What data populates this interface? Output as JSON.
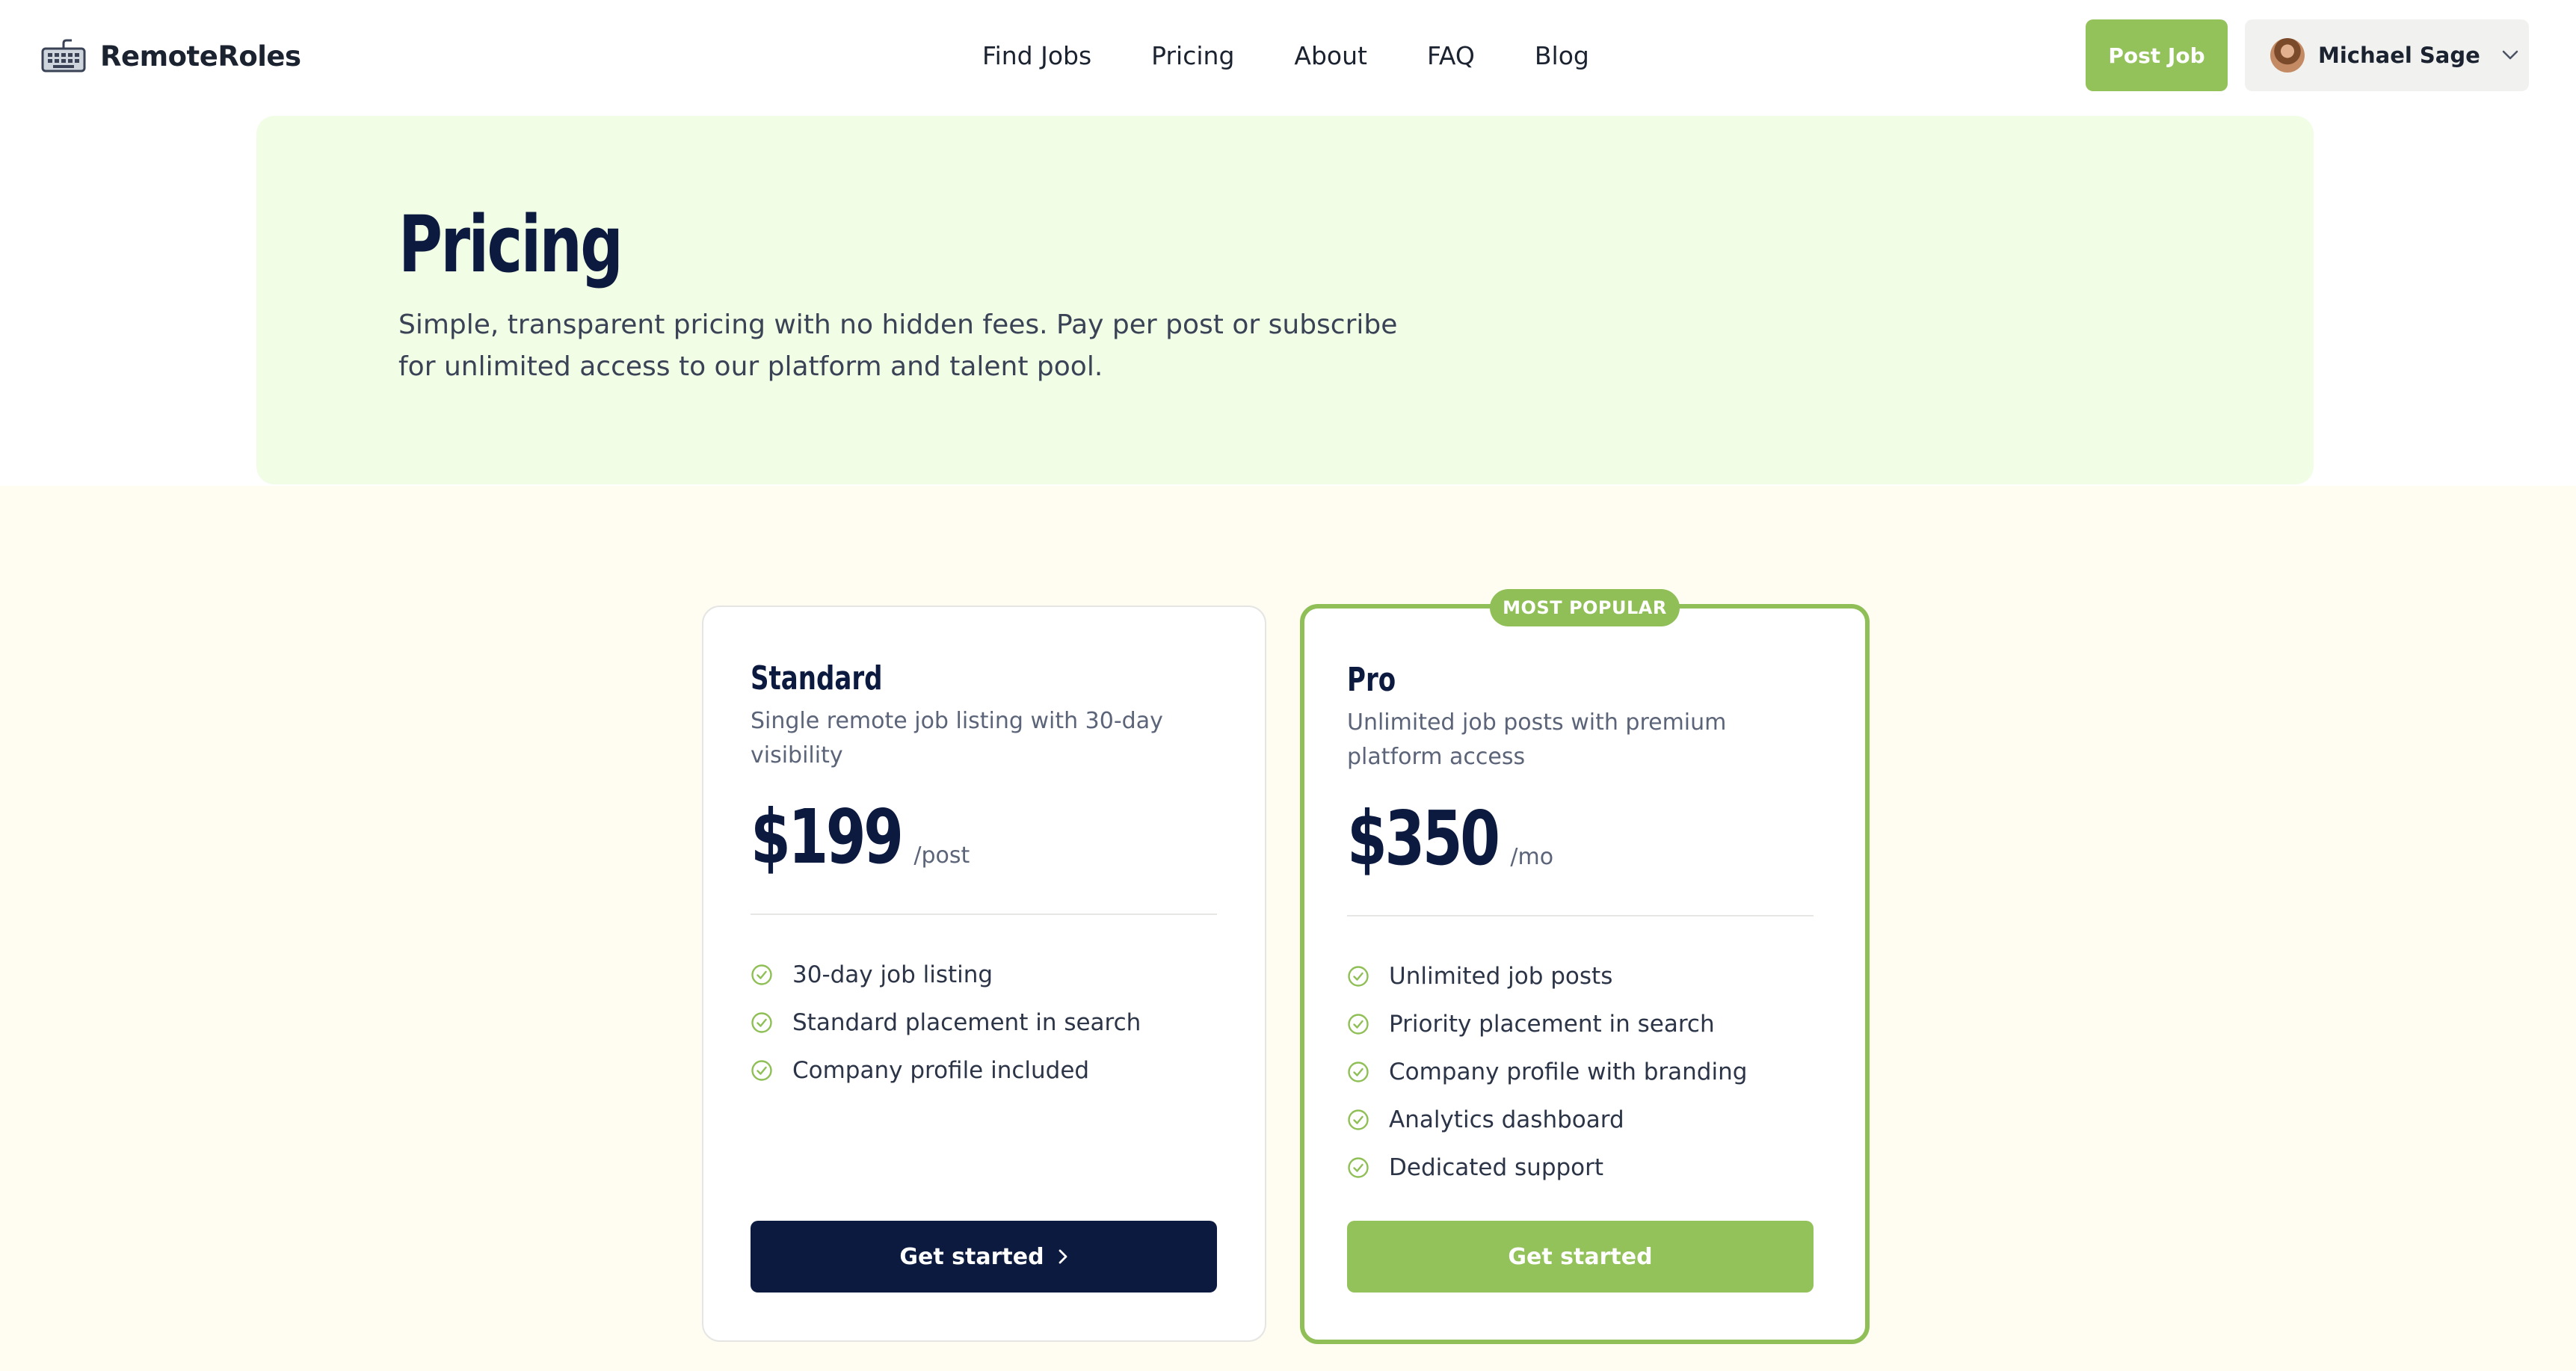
{
  "brand": {
    "name": "RemoteRoles",
    "icon": "keyboard-icon"
  },
  "nav": {
    "items": [
      {
        "label": "Find Jobs"
      },
      {
        "label": "Pricing"
      },
      {
        "label": "About"
      },
      {
        "label": "FAQ"
      },
      {
        "label": "Blog"
      }
    ]
  },
  "header": {
    "post_job_label": "Post Job",
    "user": {
      "name": "Michael Sage",
      "dropdown_icon": "chevron-down-icon"
    }
  },
  "hero": {
    "title": "Pricing",
    "subtitle_line1": "Simple, transparent pricing with no hidden fees. Pay per post or subscribe",
    "subtitle_line2": "for unlimited access to our platform and talent pool."
  },
  "plans": [
    {
      "name": "Standard",
      "description": "Single remote job listing with 30-day visibility",
      "price": "$199",
      "unit": "/post",
      "features": [
        "30-day job listing",
        "Standard placement in search",
        "Company profile included"
      ],
      "cta_label": "Get started"
    },
    {
      "name": "Pro",
      "badge": "MOST POPULAR",
      "description": "Unlimited job posts with premium platform access",
      "price": "$350",
      "unit": "/mo",
      "features": [
        "Unlimited job posts",
        "Priority placement in search",
        "Company profile with branding",
        "Analytics dashboard",
        "Dedicated support"
      ],
      "cta_label": "Get started"
    }
  ],
  "colors": {
    "accent_green": "#93c15a",
    "navy": "#0c1a3f",
    "hero_bg": "#f1fde5",
    "page_bg": "#fffcf2"
  }
}
